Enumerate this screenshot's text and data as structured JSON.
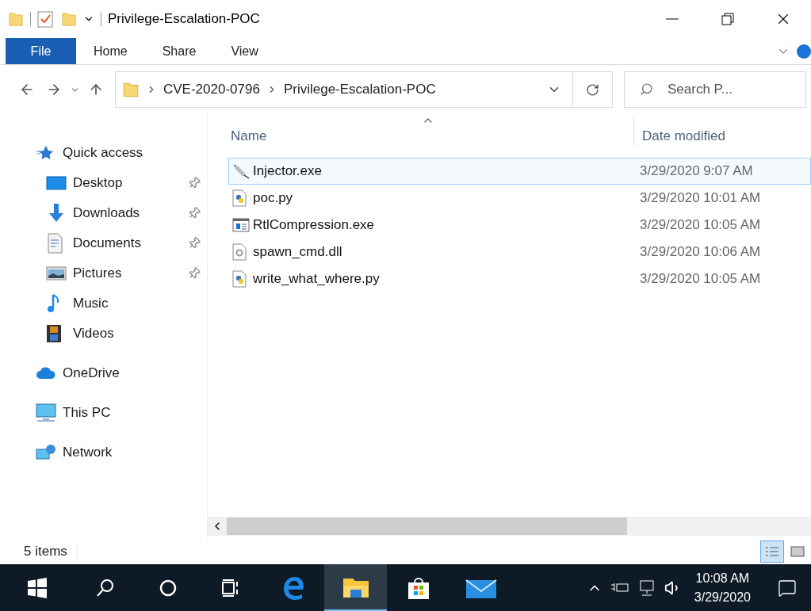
{
  "window": {
    "title": "Privilege-Escalation-POC"
  },
  "ribbon_tabs": [
    {
      "label": "File",
      "kind": "file"
    },
    {
      "label": "Home",
      "kind": "tab"
    },
    {
      "label": "Share",
      "kind": "tab"
    },
    {
      "label": "View",
      "kind": "tab"
    }
  ],
  "address_bar": {
    "segments": [
      "CVE-2020-0796",
      "Privilege-Escalation-POC"
    ]
  },
  "search": {
    "placeholder": "Search P..."
  },
  "sidebar": {
    "items": [
      {
        "label": "Quick access",
        "kind": "quick",
        "pinned": false,
        "children": [
          {
            "label": "Desktop",
            "kind": "desktop",
            "pinned": true
          },
          {
            "label": "Downloads",
            "kind": "downloads",
            "pinned": true
          },
          {
            "label": "Documents",
            "kind": "documents",
            "pinned": true
          },
          {
            "label": "Pictures",
            "kind": "pictures",
            "pinned": true
          },
          {
            "label": "Music",
            "kind": "music",
            "pinned": false
          },
          {
            "label": "Videos",
            "kind": "videos",
            "pinned": false
          }
        ]
      },
      {
        "label": "OneDrive",
        "kind": "cloud",
        "pinned": false
      },
      {
        "label": "This PC",
        "kind": "pc",
        "pinned": false
      },
      {
        "label": "Network",
        "kind": "network",
        "pinned": false
      }
    ]
  },
  "table": {
    "columns": [
      "Name",
      "Date modified"
    ],
    "rows": [
      {
        "name": "Injector.exe",
        "date": "3/29/2020 9:07 AM",
        "kind": "syringe",
        "selected": true
      },
      {
        "name": "poc.py",
        "date": "3/29/2020 10:01 AM",
        "kind": "python",
        "selected": false
      },
      {
        "name": "RtlCompression.exe",
        "date": "3/29/2020 10:05 AM",
        "kind": "app",
        "selected": false
      },
      {
        "name": "spawn_cmd.dll",
        "date": "3/29/2020 10:06 AM",
        "kind": "dll",
        "selected": false
      },
      {
        "name": "write_what_where.py",
        "date": "3/29/2020 10:05 AM",
        "kind": "python",
        "selected": false
      }
    ]
  },
  "status_bar": {
    "count": "5 items",
    "views": [
      {
        "kind": "details",
        "selected": true
      },
      {
        "kind": "thumbnails",
        "selected": false
      }
    ]
  },
  "taskbar": {
    "apps": [
      {
        "kind": "search",
        "active": false
      },
      {
        "kind": "cortana",
        "active": false
      },
      {
        "kind": "taskview",
        "active": false
      },
      {
        "kind": "edge",
        "active": false
      },
      {
        "kind": "explorer",
        "active": true
      },
      {
        "kind": "store",
        "active": false
      },
      {
        "kind": "mail",
        "active": false
      }
    ],
    "time": "10:08 AM",
    "date": "3/29/2020"
  }
}
